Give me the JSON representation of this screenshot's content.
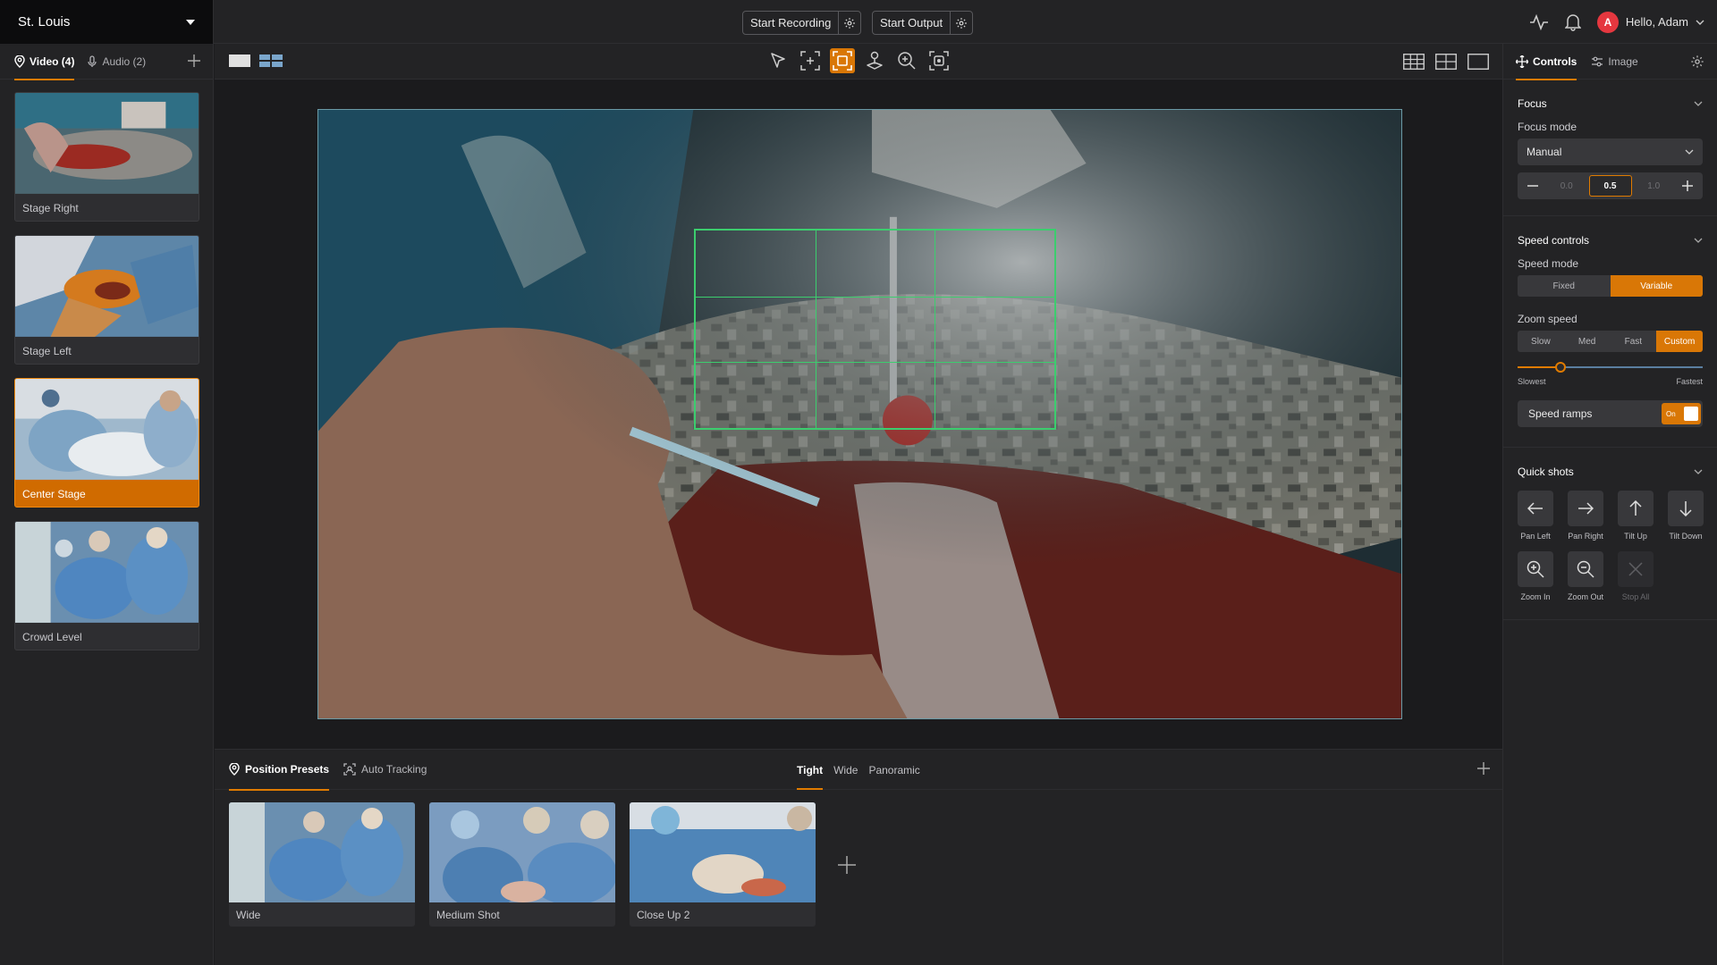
{
  "header": {
    "location": "St. Louis",
    "start_recording": "Start Recording",
    "start_output": "Start Output",
    "avatar_initial": "A",
    "greeting": "Hello, Adam"
  },
  "sources": {
    "tabs": [
      {
        "label": "Video (4)",
        "icon": "map-pin-icon",
        "active": true
      },
      {
        "label": "Audio (2)",
        "icon": "microphone-icon",
        "active": false
      }
    ],
    "cameras": [
      {
        "label": "Stage Right",
        "active": false
      },
      {
        "label": "Stage Left",
        "active": false
      },
      {
        "label": "Center Stage",
        "active": true
      },
      {
        "label": "Crowd Level",
        "active": false
      }
    ]
  },
  "toolbar": {
    "tools": [
      "pointer-icon",
      "add-frame-icon",
      "frame-select-icon",
      "joystick-icon",
      "zoom-icon",
      "focus-target-icon"
    ],
    "active_tool": "frame-select-icon",
    "layouts": [
      "grid-3x3-icon",
      "grid-2x2-icon",
      "single-view-icon"
    ]
  },
  "bottom": {
    "tabs": [
      {
        "label": "Position Presets",
        "active": true
      },
      {
        "label": "Auto Tracking",
        "active": false
      }
    ],
    "filters": [
      {
        "label": "Tight",
        "active": true
      },
      {
        "label": "Wide",
        "active": false
      },
      {
        "label": "Panoramic",
        "active": false
      }
    ],
    "presets": [
      "Wide",
      "Medium Shot",
      "Close Up 2"
    ]
  },
  "controls": {
    "tabs": [
      {
        "label": "Controls",
        "active": true
      },
      {
        "label": "Image",
        "active": false
      }
    ],
    "focus": {
      "title": "Focus",
      "mode_label": "Focus mode",
      "mode_value": "Manual",
      "min": "0.0",
      "value": "0.5",
      "max": "1.0"
    },
    "speed": {
      "title": "Speed controls",
      "mode_label": "Speed mode",
      "modes": [
        {
          "label": "Fixed",
          "on": false
        },
        {
          "label": "Variable",
          "on": true
        }
      ],
      "zoom_label": "Zoom speed",
      "zoom_options": [
        {
          "label": "Slow",
          "on": false
        },
        {
          "label": "Med",
          "on": false
        },
        {
          "label": "Fast",
          "on": false
        },
        {
          "label": "Custom",
          "on": true
        }
      ],
      "slider_value": 0.23,
      "slider_min_label": "Slowest",
      "slider_max_label": "Fastest",
      "ramps_label": "Speed ramps",
      "ramps_state": "On"
    },
    "quick_shots": {
      "title": "Quick shots",
      "items": [
        {
          "label": "Pan Left",
          "icon": "arrow-left-icon",
          "enabled": true
        },
        {
          "label": "Pan Right",
          "icon": "arrow-right-icon",
          "enabled": true
        },
        {
          "label": "Tilt Up",
          "icon": "arrow-up-icon",
          "enabled": true
        },
        {
          "label": "Tilt Down",
          "icon": "arrow-down-icon",
          "enabled": true
        },
        {
          "label": "Zoom In",
          "icon": "zoom-in-icon",
          "enabled": true
        },
        {
          "label": "Zoom Out",
          "icon": "zoom-out-icon",
          "enabled": true
        },
        {
          "label": "Stop All",
          "icon": "close-icon",
          "enabled": false
        }
      ]
    }
  },
  "colors": {
    "accent": "#d97706",
    "grid": "#3ccd6e",
    "avatar": "#e5373f"
  }
}
